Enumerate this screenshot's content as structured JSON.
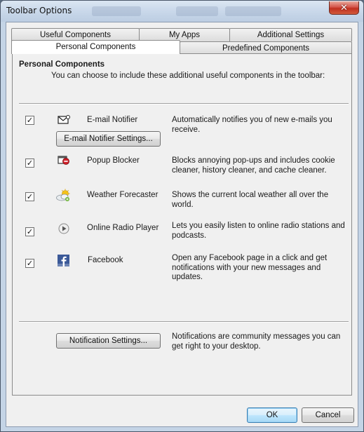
{
  "window": {
    "title": "Toolbar Options",
    "close_glyph": "✕"
  },
  "tabs": {
    "row1": [
      "Useful Components",
      "My Apps",
      "Additional Settings"
    ],
    "row2": [
      "Personal Components",
      "Predefined Components"
    ],
    "active": "Personal Components"
  },
  "section": {
    "title": "Personal Components",
    "description": "You can choose to include these additional useful components in the toolbar:"
  },
  "components": [
    {
      "name": "E-mail Notifier",
      "checked": true,
      "icon": "envelope-icon",
      "description": "Automatically notifies you of new e-mails you receive.",
      "settings_button": "E-mail Notifier Settings..."
    },
    {
      "name": "Popup Blocker",
      "checked": true,
      "icon": "popup-blocker-icon",
      "description": "Blocks annoying pop-ups and includes cookie cleaner, history cleaner, and cache cleaner."
    },
    {
      "name": "Weather Forecaster",
      "checked": true,
      "icon": "weather-icon",
      "description": "Shows the current local weather all over the world."
    },
    {
      "name": "Online Radio Player",
      "checked": true,
      "icon": "radio-play-icon",
      "description": "Lets you easily listen to online radio stations and podcasts."
    },
    {
      "name": "Facebook",
      "checked": true,
      "icon": "facebook-icon",
      "description": "Open any Facebook page in a click and get notifications with your new messages and updates."
    }
  ],
  "notification": {
    "button": "Notification Settings...",
    "description": "Notifications are community messages you can get right to your desktop."
  },
  "footer": {
    "ok": "OK",
    "cancel": "Cancel"
  },
  "colors": {
    "frame": "#c4d4e6",
    "client": "#f0f0f0",
    "close_red": "#c0301f",
    "default_button_border": "#3c7fb1",
    "facebook_blue": "#3b5998"
  }
}
